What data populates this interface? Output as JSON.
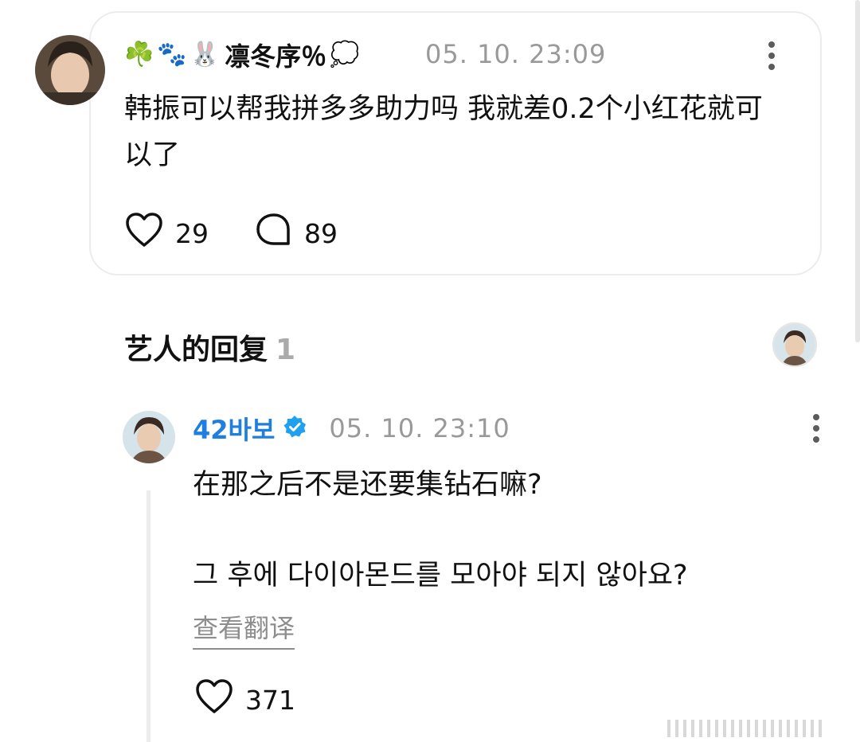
{
  "post": {
    "emojis": [
      "☘️",
      "🐾",
      "🐰"
    ],
    "emoji_trail": "💭",
    "username": "凛冬序％",
    "timestamp": "05. 10. 23:09",
    "body": "韩振可以帮我拼多多助力吗 我就差0.2个小红花就可以了",
    "likes": "29",
    "comments": "89"
  },
  "section": {
    "title": "艺人的回复",
    "count": "1"
  },
  "reply": {
    "username": "42바보",
    "timestamp": "05. 10. 23:10",
    "text_zh": "在那之后不是还要集钻石嘛?",
    "text_ko": "그 후에 다이아몬드를 모아야 되지 않아요?",
    "translate_label": "查看翻译",
    "likes": "371"
  },
  "colors": {
    "accent_name": "#1e7fe0",
    "verified": "#1fa0f0",
    "muted": "#999999"
  }
}
